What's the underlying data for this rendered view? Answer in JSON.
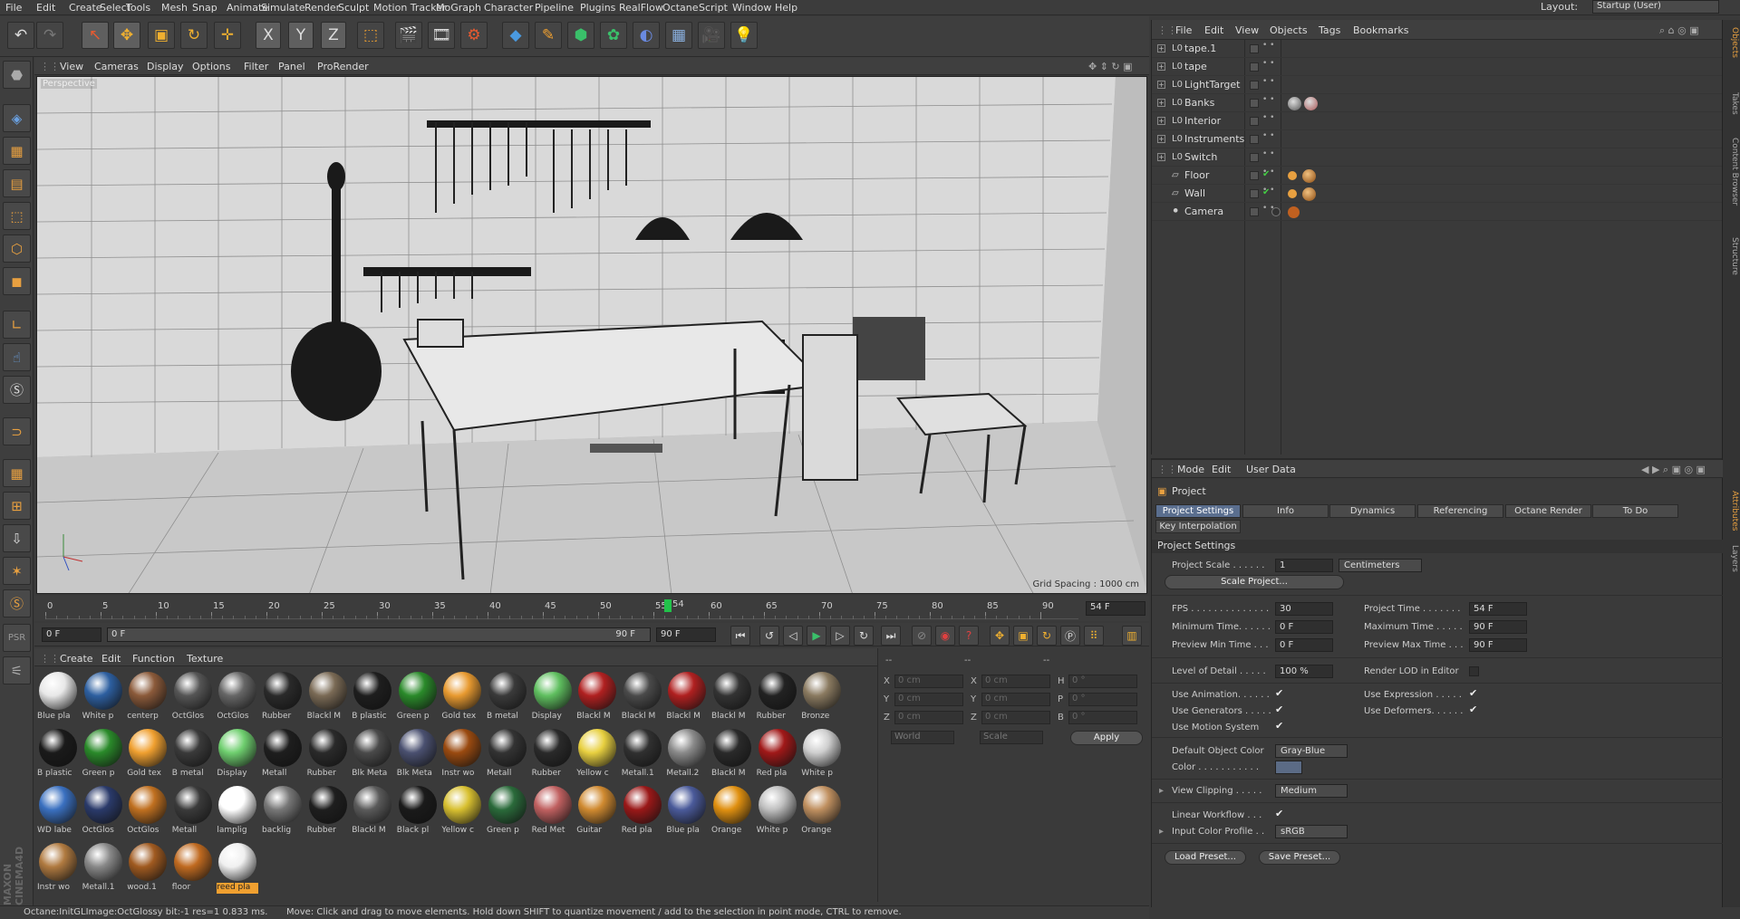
{
  "menu": [
    "File",
    "Edit",
    "Create",
    "Select",
    "Tools",
    "Mesh",
    "Snap",
    "Animate",
    "Simulate",
    "Render",
    "Sculpt",
    "Motion Tracker",
    "MoGraph",
    "Character",
    "Pipeline",
    "Plugins",
    "RealFlow",
    "Octane",
    "Script",
    "Window",
    "Help"
  ],
  "layout": {
    "label": "Layout:",
    "value": "Startup (User)"
  },
  "toolbar": {
    "x": "X",
    "y": "Y",
    "z": "Z"
  },
  "viewport_menu": [
    "View",
    "Cameras",
    "Display",
    "Options",
    "Filter",
    "Panel",
    "ProRender"
  ],
  "viewport": {
    "label": "Perspective",
    "grid_spacing": "Grid Spacing : 1000 cm"
  },
  "timeline": {
    "ticks": [
      "0",
      "5",
      "10",
      "15",
      "20",
      "25",
      "30",
      "35",
      "40",
      "45",
      "50",
      "55",
      "60",
      "65",
      "70",
      "75",
      "80",
      "85",
      "90"
    ],
    "playhead": "54",
    "current_frame": "54 F",
    "start": "0 F",
    "range_start": "0 F",
    "range_end": "90 F",
    "end": "90 F"
  },
  "material_menu": [
    "Create",
    "Edit",
    "Function",
    "Texture"
  ],
  "materials": [
    {
      "label": "Blue pla",
      "color": "#e8e8e8"
    },
    {
      "label": "White p",
      "color": "#2d5fa0"
    },
    {
      "label": "centerp",
      "color": "#8b5a3a"
    },
    {
      "label": "OctGlos",
      "color": "#555"
    },
    {
      "label": "OctGlos",
      "color": "#666"
    },
    {
      "label": "Rubber",
      "color": "#2a2a2a"
    },
    {
      "label": "Blackl M",
      "color": "#7a6a55"
    },
    {
      "label": "B plastic",
      "color": "#1e1e1e"
    },
    {
      "label": "Green p",
      "color": "#2a8a2a"
    },
    {
      "label": "Gold tex",
      "color": "#e89a30"
    },
    {
      "label": "B metal",
      "color": "#3a3a3a"
    },
    {
      "label": "Display",
      "color": "#5fbf5f"
    },
    {
      "label": "Blackl M",
      "color": "#b02020"
    },
    {
      "label": "Blackl M",
      "color": "#4a4a4a"
    },
    {
      "label": "Blackl M",
      "color": "#b02020"
    },
    {
      "label": "Blackl M",
      "color": "#333"
    },
    {
      "label": "Rubber",
      "color": "#222"
    },
    {
      "label": "Bronze",
      "color": "#8a7a60"
    },
    {
      "label": "B plastic",
      "color": "#1a1a1a"
    },
    {
      "label": "Green p",
      "color": "#2a8a2a"
    },
    {
      "label": "Gold tex",
      "color": "#f0a030"
    },
    {
      "label": "B metal",
      "color": "#3a3a3a"
    },
    {
      "label": "Display",
      "color": "#6fcf6f"
    },
    {
      "label": "Metall",
      "color": "#1e1e1e"
    },
    {
      "label": "Rubber",
      "color": "#2a2a2a"
    },
    {
      "label": "Blk Meta",
      "color": "#4a4a4a"
    },
    {
      "label": "Blk Meta",
      "color": "#4a5070"
    },
    {
      "label": "Instr wo",
      "color": "#9a4a10"
    },
    {
      "label": "Metall",
      "color": "#333"
    },
    {
      "label": "Rubber",
      "color": "#2a2a2a"
    },
    {
      "label": "Yellow c",
      "color": "#e8d040"
    },
    {
      "label": "Metall.1",
      "color": "#303030"
    },
    {
      "label": "Metall.2",
      "color": "#8a8a8a"
    },
    {
      "label": "Blackl M",
      "color": "#2a2a2a"
    },
    {
      "label": "Red pla",
      "color": "#a01818"
    },
    {
      "label": "White p",
      "color": "#cfcfcf"
    },
    {
      "label": "WD labe",
      "color": "#3a70c0"
    },
    {
      "label": "OctGlos",
      "color": "#2a3a6a"
    },
    {
      "label": "OctGlos",
      "color": "#c07020"
    },
    {
      "label": "Metall",
      "color": "#3a3a3a"
    },
    {
      "label": "lamplig",
      "color": "#ffffff"
    },
    {
      "label": "backlig",
      "color": "#777"
    },
    {
      "label": "Rubber",
      "color": "#1e1e1e"
    },
    {
      "label": "Blackl M",
      "color": "#5a5a5a"
    },
    {
      "label": "Black pl",
      "color": "#1a1a1a"
    },
    {
      "label": "Yellow c",
      "color": "#d8c030"
    },
    {
      "label": "Green p",
      "color": "#2a6a3a"
    },
    {
      "label": "Red Met",
      "color": "#c06060"
    },
    {
      "label": "Guitar",
      "color": "#d08a30"
    },
    {
      "label": "Red pla",
      "color": "#9a1818"
    },
    {
      "label": "Blue pla",
      "color": "#4a5a9a"
    },
    {
      "label": "Orange",
      "color": "#e09010"
    },
    {
      "label": "White p",
      "color": "#bfbfbf"
    },
    {
      "label": "Orange",
      "color": "#c09060"
    },
    {
      "label": "Instr wo",
      "color": "#b07a40"
    },
    {
      "label": "Metall.1",
      "color": "#888"
    },
    {
      "label": "wood.1",
      "color": "#a05a20"
    },
    {
      "label": "floor",
      "color": "#c06a20"
    },
    {
      "label": "reed pla",
      "color": "#f0f0f0",
      "selected": true
    }
  ],
  "coords": {
    "x1": "0 cm",
    "y1": "0 cm",
    "z1": "0 cm",
    "x2": "0 cm",
    "y2": "0 cm",
    "z2": "0 cm",
    "h": "0 °",
    "p": "0 °",
    "b": "0 °",
    "dash": "--",
    "world": "World",
    "scale": "Scale",
    "apply": "Apply",
    "lx": "X",
    "ly": "Y",
    "lz": "Z",
    "lh": "H",
    "lp": "P",
    "lb": "B"
  },
  "status": {
    "left": "Octane:InitGLImage:OctGlossy  bit:-1 res=1  0.833 ms.",
    "msg": "Move: Click and drag to move elements. Hold down SHIFT to quantize movement / add to the selection in point mode, CTRL to remove."
  },
  "objmenu": [
    "File",
    "Edit",
    "View",
    "Objects",
    "Tags",
    "Bookmarks"
  ],
  "objects": [
    {
      "name": "tape.1",
      "icon": "L0"
    },
    {
      "name": "tape",
      "icon": "L0"
    },
    {
      "name": "LightTarget",
      "icon": "L0"
    },
    {
      "name": "Banks",
      "icon": "L0"
    },
    {
      "name": "Interior",
      "icon": "L0"
    },
    {
      "name": "Instruments",
      "icon": "L0"
    },
    {
      "name": "Switch",
      "icon": "L0"
    },
    {
      "name": "Floor",
      "icon": "▱"
    },
    {
      "name": "Wall",
      "icon": "▱"
    },
    {
      "name": "Camera",
      "icon": "⚫"
    }
  ],
  "sidetabs": [
    "Objects",
    "Takes",
    "Content Browser",
    "Structure",
    "Attributes",
    "Layers"
  ],
  "attr": {
    "menu": [
      "Mode",
      "Edit",
      "User Data"
    ],
    "title": "Project",
    "tabs": [
      "Project Settings",
      "Info",
      "Dynamics",
      "Referencing",
      "Octane Render",
      "To Do"
    ],
    "tab2": "Key Interpolation",
    "section": "Project Settings",
    "project_scale_label": "Project Scale . . . . . .",
    "project_scale": "1",
    "units": "Centimeters",
    "scale_btn": "Scale Project...",
    "fps_label": "FPS . . . . . . . . . . . . . .",
    "fps": "30",
    "ptime_label": "Project Time . . . . . . .",
    "ptime": "54 F",
    "mintime_label": "Minimum Time. . . . . .",
    "mintime": "0 F",
    "maxtime_label": "Maximum Time . . . . .",
    "maxtime": "90 F",
    "pmin_label": "Preview Min Time . . .",
    "pmin": "0 F",
    "pmax_label": "Preview Max Time . . .",
    "pmax": "90 F",
    "lod_label": "Level of Detail . . . . .",
    "lod": "100 %",
    "rlod_label": "Render LOD in Editor",
    "useanim": "Use Animation. . . . . .",
    "useexpr": "Use Expression . . . . .",
    "usegen": "Use Generators . . . . .",
    "usedef": "Use Deformers. . . . . .",
    "usemot": "Use Motion System",
    "defcolor_label": "Default Object Color",
    "defcolor": "Gray-Blue",
    "color_label": "Color . . . . . . . . . . .",
    "viewclip_label": "View Clipping . . . . .",
    "viewclip": "Medium",
    "linwf": "Linear Workflow . . .",
    "icp_label": "Input Color Profile . .",
    "icp": "sRGB",
    "load": "Load Preset...",
    "save": "Save Preset..."
  }
}
